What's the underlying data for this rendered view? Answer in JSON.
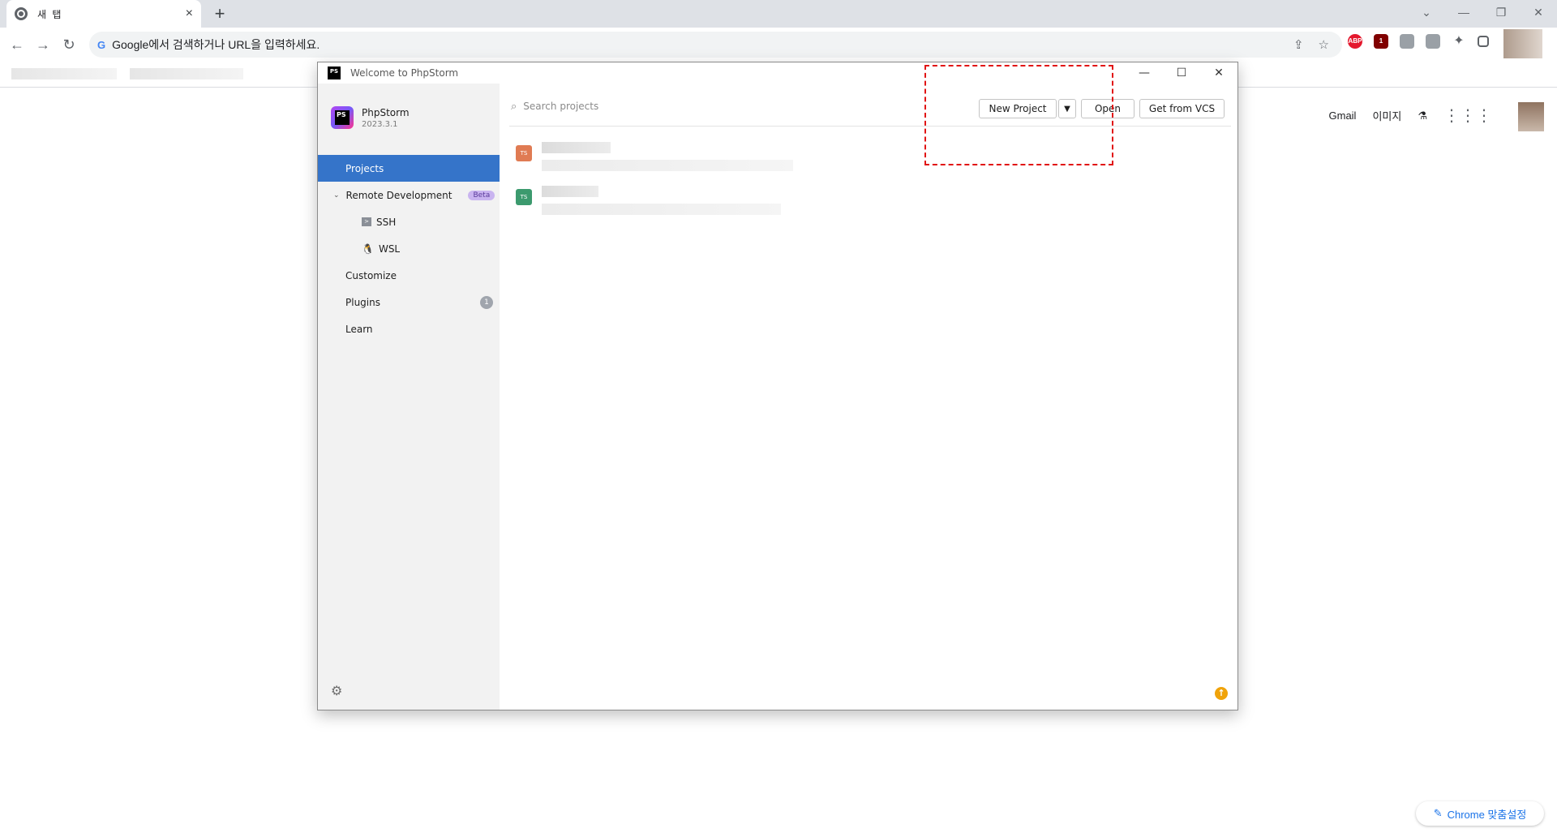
{
  "browser": {
    "tab_title": "새 탭",
    "tab_close": "×",
    "new_tab": "+",
    "omnibox_placeholder": "Google에서 검색하거나 URL을 입력하세요.",
    "window_controls": [
      "⌄",
      "—",
      "❐",
      "✕"
    ],
    "extensions": {
      "abp": "ABP",
      "ublock_badge": "1"
    }
  },
  "ntp": {
    "gmail": "Gmail",
    "images": "이미지",
    "customize": "Chrome 맞춤설정"
  },
  "phpstorm": {
    "window_title": "Welcome to PhpStorm",
    "product_name": "PhpStorm",
    "version": "2023.3.1",
    "search_placeholder": "Search projects",
    "buttons": {
      "new_project": "New Project",
      "open": "Open",
      "get_from_vcs": "Get from VCS"
    },
    "nav": [
      {
        "label": "Projects"
      },
      {
        "label": "Remote Development",
        "badge": "Beta"
      },
      {
        "label": "SSH"
      },
      {
        "label": "WSL"
      },
      {
        "label": "Customize"
      },
      {
        "label": "Plugins",
        "badge": "1"
      },
      {
        "label": "Learn"
      }
    ],
    "projects": [
      {
        "icon_text": "TS",
        "icon_color": "#e07b53"
      },
      {
        "icon_text": "TS",
        "icon_color": "#3c9a6e"
      }
    ],
    "accent_color": "#3574c9"
  }
}
